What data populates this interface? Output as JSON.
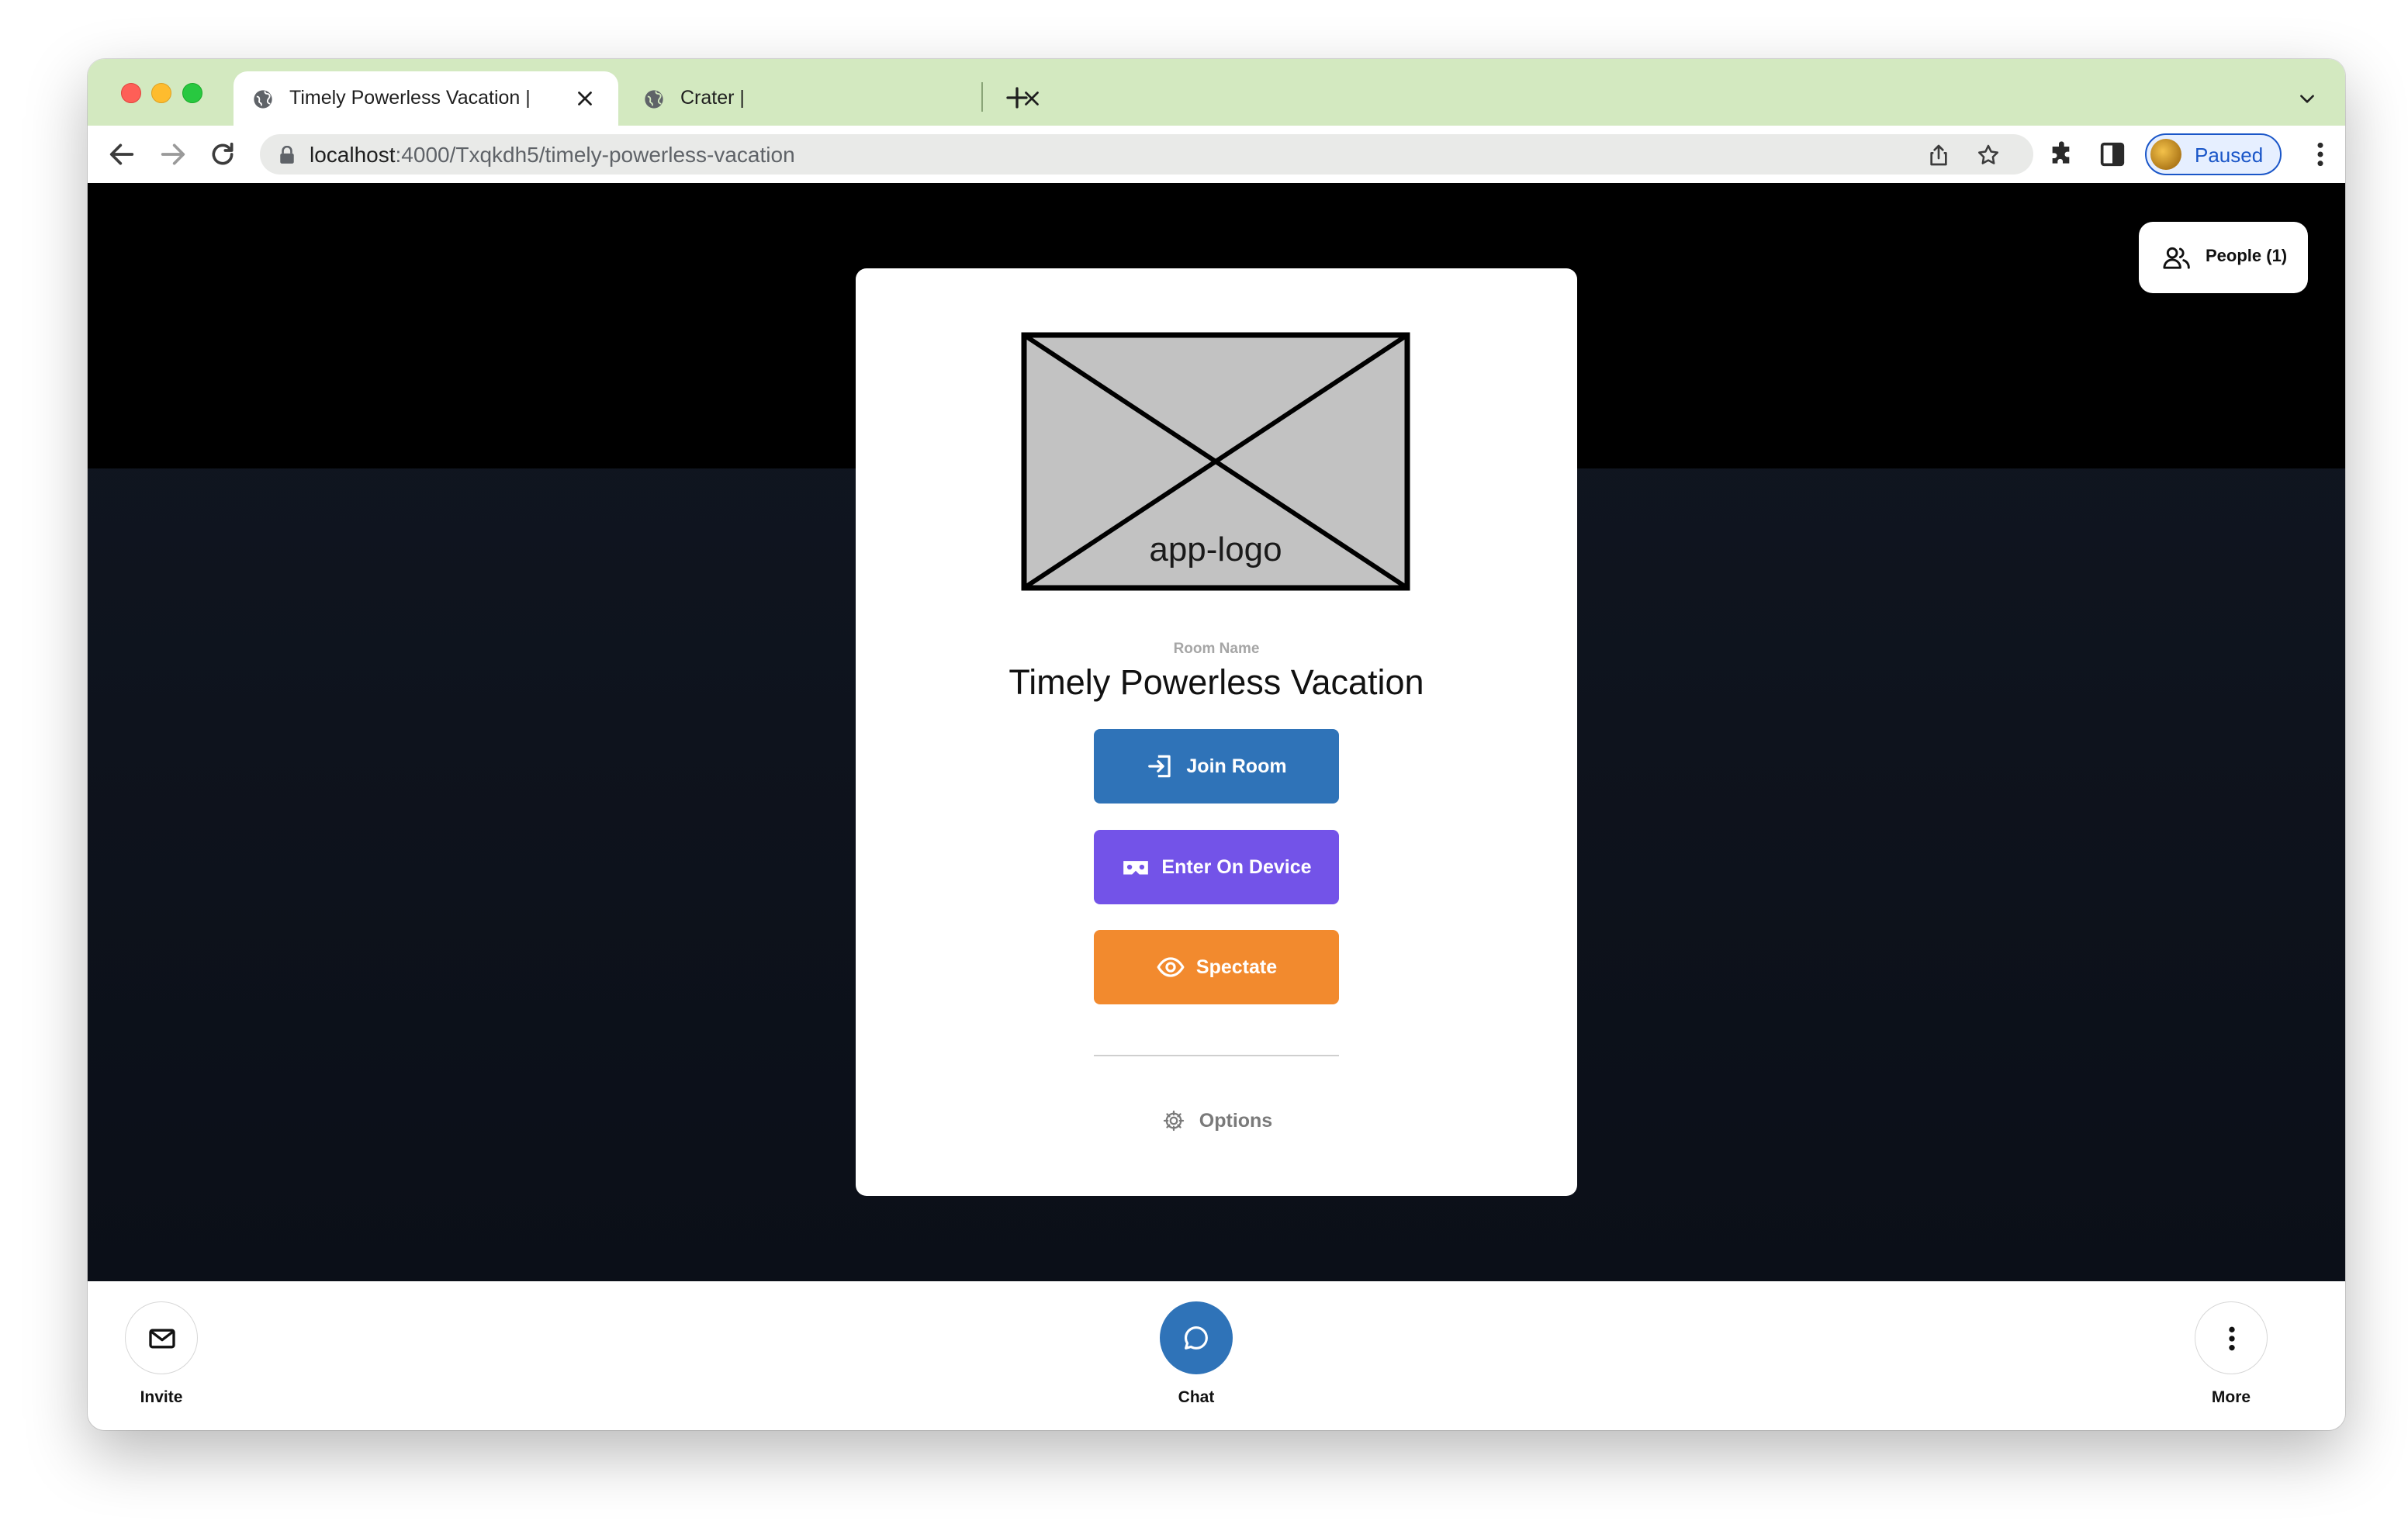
{
  "browser": {
    "tabs": [
      {
        "title": "Timely Powerless Vacation |",
        "active": true
      },
      {
        "title": "Crater |",
        "active": false
      }
    ],
    "url_host": "localhost",
    "url_path": ":4000/Txqkdh5/timely-powerless-vacation",
    "profile_label": "Paused"
  },
  "header": {
    "people_label": "People (1)"
  },
  "card": {
    "logo_text": "app-logo",
    "room_caption": "Room Name",
    "room_name": "Timely Powerless Vacation",
    "buttons": {
      "join": "Join Room",
      "device": "Enter On Device",
      "spectate": "Spectate"
    },
    "options_label": "Options"
  },
  "bottombar": {
    "invite_label": "Invite",
    "chat_label": "Chat",
    "more_label": "More"
  },
  "colors": {
    "tabbar": "#d3e9c0",
    "join": "#2f73b8",
    "device": "#7353e8",
    "spectate": "#f28a2e",
    "chat": "#2f73b8"
  },
  "icons": [
    "globe-icon",
    "close-icon",
    "plus-icon",
    "chevron-down-icon",
    "back-arrow-icon",
    "forward-arrow-icon",
    "reload-icon",
    "lock-icon",
    "share-icon",
    "star-icon",
    "puzzle-icon",
    "sidebar-icon",
    "kebab-menu-icon",
    "people-icon",
    "login-icon",
    "vr-headset-icon",
    "eye-icon",
    "gear-icon",
    "mail-icon",
    "chat-bubble-icon"
  ]
}
